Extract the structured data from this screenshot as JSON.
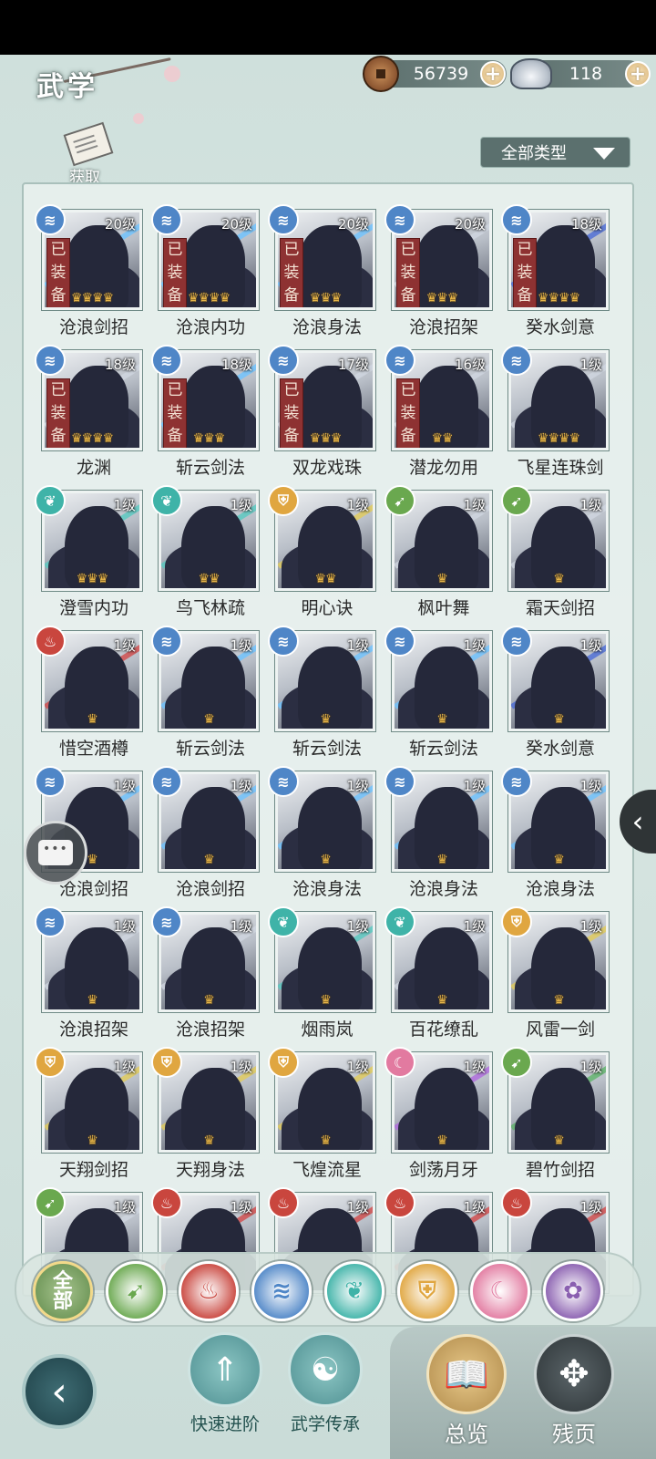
{
  "header": {
    "title": "武学",
    "coins": {
      "value": "56739",
      "icon": "copper-coin-icon"
    },
    "silver": {
      "value": "118",
      "icon": "silver-ingot-icon"
    }
  },
  "acquire": {
    "label": "获取"
  },
  "type_filter": {
    "label": "全部类型"
  },
  "equipped_label": "已装备",
  "skills": [
    {
      "name": "沧浪剑招",
      "level": "20级",
      "equipped": true,
      "stars": "♛♛♛♛",
      "school": "wave",
      "slash": "#6ec3ff"
    },
    {
      "name": "沧浪内功",
      "level": "20级",
      "equipped": true,
      "stars": "♛♛♛♛",
      "school": "wave",
      "slash": "#6ec3ff"
    },
    {
      "name": "沧浪身法",
      "level": "20级",
      "equipped": true,
      "stars": "♛♛♛",
      "school": "wave",
      "slash": "#6ec3ff"
    },
    {
      "name": "沧浪招架",
      "level": "20级",
      "equipped": true,
      "stars": "♛♛♛",
      "school": "wave",
      "slash": "#cfd6e0"
    },
    {
      "name": "癸水剑意",
      "level": "18级",
      "equipped": true,
      "stars": "♛♛♛♛",
      "school": "wave",
      "slash": "#4b6bd6"
    },
    {
      "name": "龙渊",
      "level": "18级",
      "equipped": true,
      "stars": "♛♛♛♛",
      "school": "wave",
      "slash": "#cfd6e0"
    },
    {
      "name": "斩云剑法",
      "level": "18级",
      "equipped": true,
      "stars": "♛♛♛",
      "school": "wave",
      "slash": "#6ec3ff"
    },
    {
      "name": "双龙戏珠",
      "level": "17级",
      "equipped": true,
      "stars": "♛♛♛",
      "school": "wave",
      "slash": "#cfd6e0"
    },
    {
      "name": "潜龙勿用",
      "level": "16级",
      "equipped": true,
      "stars": "♛♛",
      "school": "wave",
      "slash": "#cfd6e0"
    },
    {
      "name": "飞星连珠剑",
      "level": "1级",
      "equipped": false,
      "stars": "♛♛♛♛",
      "school": "wave",
      "slash": "#cfd6e0"
    },
    {
      "name": "澄雪内功",
      "level": "1级",
      "equipped": false,
      "stars": "♛♛♛",
      "school": "butterfly",
      "slash": "#58c9c0"
    },
    {
      "name": "鸟飞林疏",
      "level": "1级",
      "equipped": false,
      "stars": "♛♛",
      "school": "butterfly",
      "slash": "#58c9c0"
    },
    {
      "name": "明心诀",
      "level": "1级",
      "equipped": false,
      "stars": "♛♛",
      "school": "shield",
      "slash": "#e2cc5a"
    },
    {
      "name": "枫叶舞",
      "level": "1级",
      "equipped": false,
      "stars": "♛",
      "school": "leaf",
      "slash": "#cfd6e0"
    },
    {
      "name": "霜天剑招",
      "level": "1级",
      "equipped": false,
      "stars": "♛",
      "school": "leaf",
      "slash": "#cfd6e0"
    },
    {
      "name": "惜空酒樽",
      "level": "1级",
      "equipped": false,
      "stars": "♛",
      "school": "flame",
      "slash": "#d24a4a"
    },
    {
      "name": "斩云剑法",
      "level": "1级",
      "equipped": false,
      "stars": "♛",
      "school": "wave",
      "slash": "#6ec3ff"
    },
    {
      "name": "斩云剑法",
      "level": "1级",
      "equipped": false,
      "stars": "♛",
      "school": "wave",
      "slash": "#6ec3ff"
    },
    {
      "name": "斩云剑法",
      "level": "1级",
      "equipped": false,
      "stars": "♛",
      "school": "wave",
      "slash": "#6ec3ff"
    },
    {
      "name": "癸水剑意",
      "level": "1级",
      "equipped": false,
      "stars": "♛",
      "school": "wave",
      "slash": "#4b6bd6"
    },
    {
      "name": "沧浪剑招",
      "level": "1级",
      "equipped": false,
      "stars": "♛",
      "school": "wave",
      "slash": "#6ec3ff"
    },
    {
      "name": "沧浪剑招",
      "level": "1级",
      "equipped": false,
      "stars": "♛",
      "school": "wave",
      "slash": "#6ec3ff"
    },
    {
      "name": "沧浪身法",
      "level": "1级",
      "equipped": false,
      "stars": "♛",
      "school": "wave",
      "slash": "#6ec3ff"
    },
    {
      "name": "沧浪身法",
      "level": "1级",
      "equipped": false,
      "stars": "♛",
      "school": "wave",
      "slash": "#6ec3ff"
    },
    {
      "name": "沧浪身法",
      "level": "1级",
      "equipped": false,
      "stars": "♛",
      "school": "wave",
      "slash": "#6ec3ff"
    },
    {
      "name": "沧浪招架",
      "level": "1级",
      "equipped": false,
      "stars": "♛",
      "school": "wave",
      "slash": "#cfd6e0"
    },
    {
      "name": "沧浪招架",
      "level": "1级",
      "equipped": false,
      "stars": "♛",
      "school": "wave",
      "slash": "#cfd6e0"
    },
    {
      "name": "烟雨岚",
      "level": "1级",
      "equipped": false,
      "stars": "♛",
      "school": "butterfly",
      "slash": "#58c9c0"
    },
    {
      "name": "百花缭乱",
      "level": "1级",
      "equipped": false,
      "stars": "♛",
      "school": "butterfly",
      "slash": "#cfd6e0"
    },
    {
      "name": "风雷一剑",
      "level": "1级",
      "equipped": false,
      "stars": "♛",
      "school": "shield",
      "slash": "#e2cc5a"
    },
    {
      "name": "天翔剑招",
      "level": "1级",
      "equipped": false,
      "stars": "♛",
      "school": "shield",
      "slash": "#e2cc5a"
    },
    {
      "name": "天翔身法",
      "level": "1级",
      "equipped": false,
      "stars": "♛",
      "school": "shield",
      "slash": "#e2cc5a"
    },
    {
      "name": "飞煌流星",
      "level": "1级",
      "equipped": false,
      "stars": "♛",
      "school": "shield",
      "slash": "#e2cc5a"
    },
    {
      "name": "剑荡月牙",
      "level": "1级",
      "equipped": false,
      "stars": "♛",
      "school": "moon",
      "slash": "#b06adf"
    },
    {
      "name": "碧竹剑招",
      "level": "1级",
      "equipped": false,
      "stars": "♛",
      "school": "leaf",
      "slash": "#5fb46a"
    },
    {
      "name": "",
      "level": "1级",
      "equipped": false,
      "stars": "",
      "school": "leaf",
      "slash": "#cfd6e0"
    },
    {
      "name": "",
      "level": "1级",
      "equipped": false,
      "stars": "",
      "school": "flame",
      "slash": "#d24a4a"
    },
    {
      "name": "",
      "level": "1级",
      "equipped": false,
      "stars": "",
      "school": "flame",
      "slash": "#d24a4a"
    },
    {
      "name": "",
      "level": "1级",
      "equipped": false,
      "stars": "",
      "school": "flame",
      "slash": "#d24a4a"
    },
    {
      "name": "",
      "level": "1级",
      "equipped": false,
      "stars": "",
      "school": "flame",
      "slash": "#d24a4a"
    }
  ],
  "school_colors": {
    "wave": "#4f86c7",
    "butterfly": "#3fb3a8",
    "shield": "#e0a640",
    "leaf": "#6aa84f",
    "flame": "#c9463e",
    "moon": "#e27aa0",
    "rose": "#8a5fb0"
  },
  "school_glyphs": {
    "wave": "≋",
    "butterfly": "❦",
    "shield": "⛨",
    "leaf": "➹",
    "flame": "♨",
    "moon": "☾",
    "rose": "✿"
  },
  "filter_tabs": [
    {
      "label": "全\n部",
      "school": "all"
    },
    {
      "label": "",
      "school": "leaf"
    },
    {
      "label": "",
      "school": "flame"
    },
    {
      "label": "",
      "school": "wave"
    },
    {
      "label": "",
      "school": "butterfly"
    },
    {
      "label": "",
      "school": "shield"
    },
    {
      "label": "",
      "school": "moon"
    },
    {
      "label": "",
      "school": "rose"
    }
  ],
  "bottom": {
    "quick_advance": "快速进阶",
    "inherit": "武学传承",
    "overview": "总览",
    "fragments": "残页"
  }
}
